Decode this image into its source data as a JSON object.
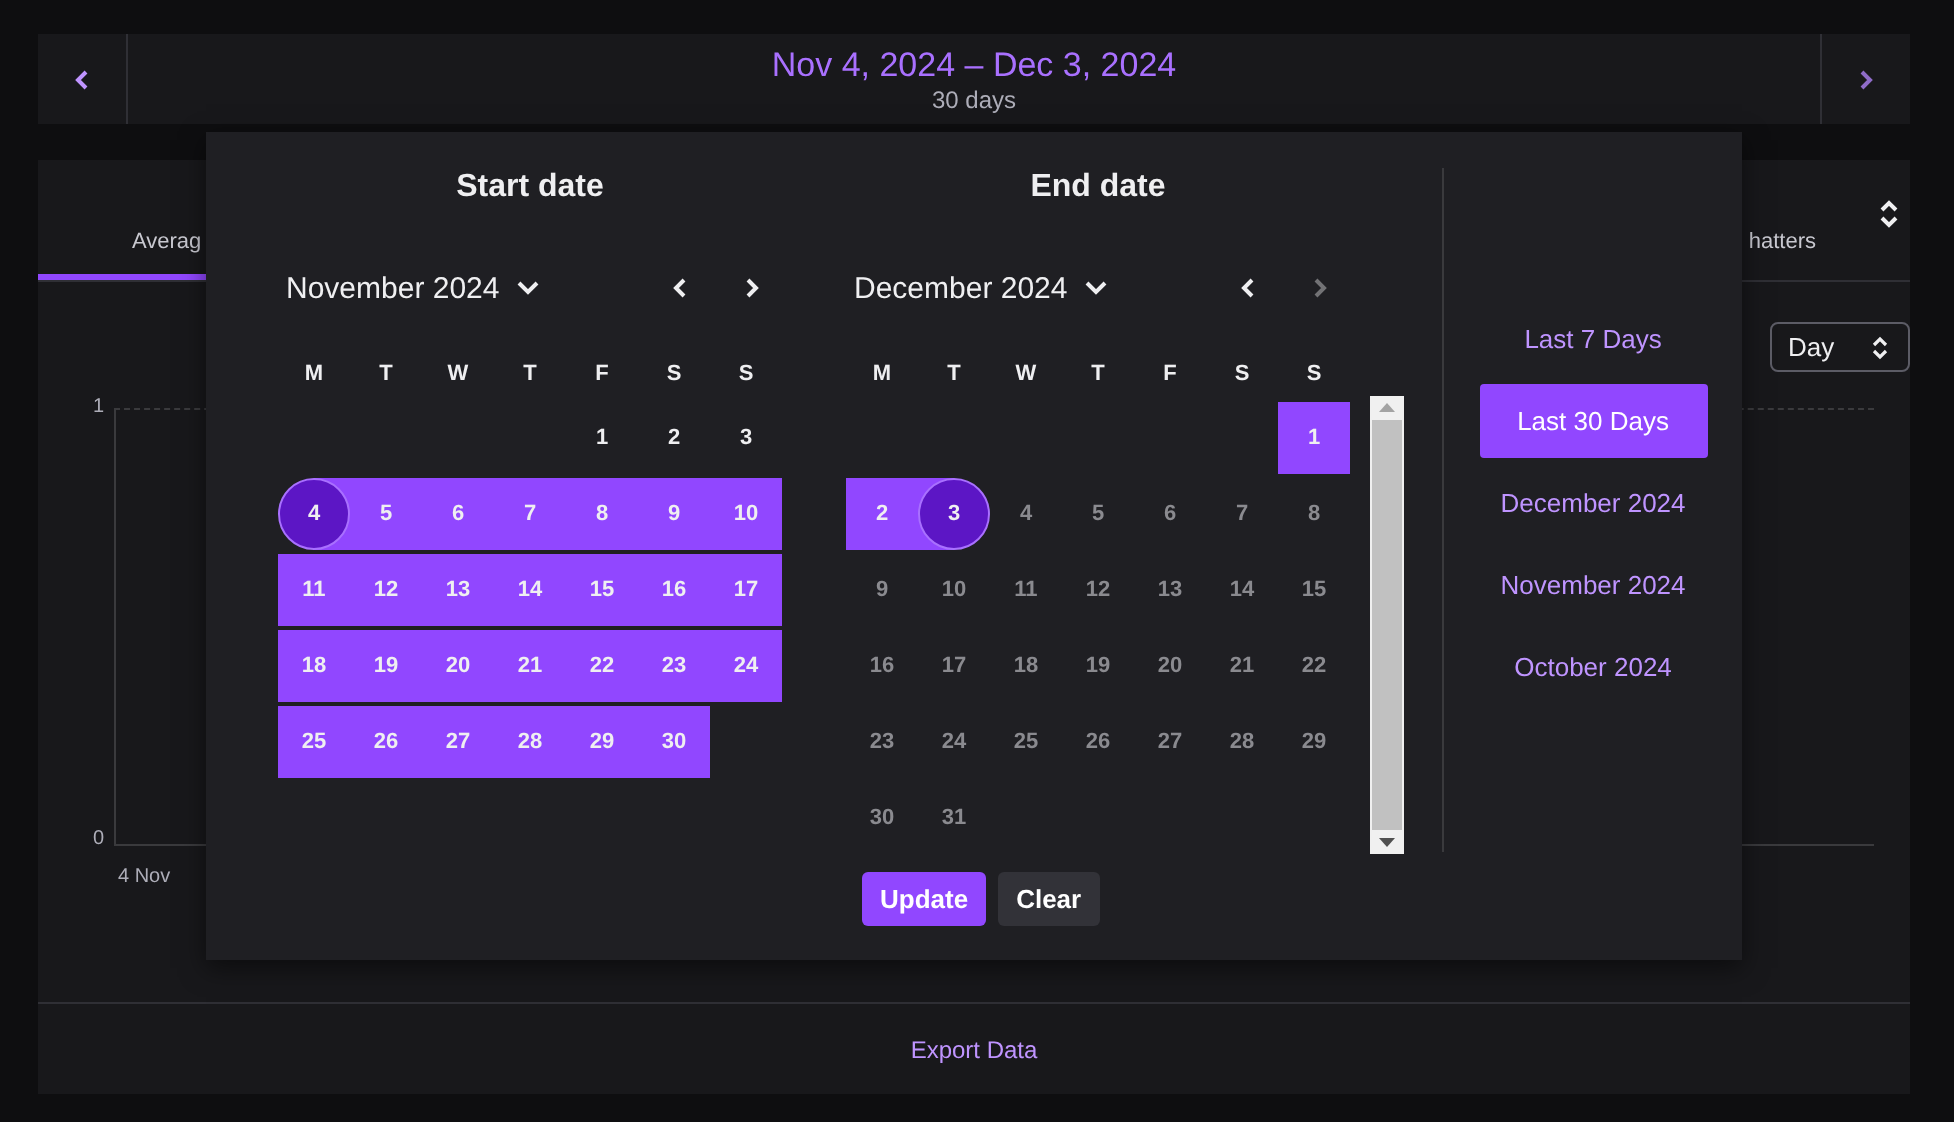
{
  "date_range_bar": {
    "title": "Nov 4, 2024 – Dec 3, 2024",
    "subtitle": "30 days"
  },
  "stats_card": {
    "tabs": [
      {
        "label": "Averag",
        "selected": true
      },
      {
        "label": "hatters",
        "selected": false
      }
    ],
    "interval_select": {
      "value": "Day"
    },
    "chart": {
      "y_labels": [
        "1",
        "0"
      ],
      "x_labels": [
        "4 Nov"
      ]
    },
    "export_button": "Export Data"
  },
  "date_picker": {
    "calendars": [
      {
        "heading": "Start date",
        "month": "November 2024",
        "prev_disabled": false,
        "next_disabled": false,
        "scrollbar": false,
        "weekdays": [
          "M",
          "T",
          "W",
          "T",
          "F",
          "S",
          "S"
        ],
        "weeks": [
          [
            {
              "day": "1",
              "selected": false,
              "dimmed": false
            },
            {
              "day": "2",
              "selected": false,
              "dimmed": false
            },
            {
              "day": "3",
              "selected": false,
              "dimmed": false
            }
          ],
          [
            {
              "day": "4",
              "selected": true,
              "kind": "range_start",
              "dimmed": false
            },
            {
              "day": "5",
              "selected": true,
              "dimmed": false
            },
            {
              "day": "6",
              "selected": true,
              "dimmed": false
            },
            {
              "day": "7",
              "selected": true,
              "dimmed": false
            },
            {
              "day": "8",
              "selected": true,
              "dimmed": false
            },
            {
              "day": "9",
              "selected": true,
              "dimmed": false
            },
            {
              "day": "10",
              "selected": true,
              "dimmed": false
            }
          ],
          [
            {
              "day": "11",
              "selected": true,
              "dimmed": false
            },
            {
              "day": "12",
              "selected": true,
              "dimmed": false
            },
            {
              "day": "13",
              "selected": true,
              "dimmed": false
            },
            {
              "day": "14",
              "selected": true,
              "dimmed": false
            },
            {
              "day": "15",
              "selected": true,
              "dimmed": false
            },
            {
              "day": "16",
              "selected": true,
              "dimmed": false
            },
            {
              "day": "17",
              "selected": true,
              "dimmed": false
            }
          ],
          [
            {
              "day": "18",
              "selected": true,
              "dimmed": false
            },
            {
              "day": "19",
              "selected": true,
              "dimmed": false
            },
            {
              "day": "20",
              "selected": true,
              "dimmed": false
            },
            {
              "day": "21",
              "selected": true,
              "dimmed": false
            },
            {
              "day": "22",
              "selected": true,
              "dimmed": false
            },
            {
              "day": "23",
              "selected": true,
              "dimmed": false
            },
            {
              "day": "24",
              "selected": true,
              "dimmed": false
            }
          ],
          [
            {
              "day": "25",
              "selected": true,
              "dimmed": false
            },
            {
              "day": "26",
              "selected": true,
              "dimmed": false
            },
            {
              "day": "27",
              "selected": true,
              "dimmed": false
            },
            {
              "day": "28",
              "selected": true,
              "dimmed": false
            },
            {
              "day": "29",
              "selected": true,
              "dimmed": false
            },
            {
              "day": "30",
              "selected": true,
              "dimmed": false
            }
          ]
        ]
      },
      {
        "heading": "End date",
        "month": "December 2024",
        "prev_disabled": false,
        "next_disabled": true,
        "scrollbar": true,
        "weekdays": [
          "M",
          "T",
          "W",
          "T",
          "F",
          "S",
          "S"
        ],
        "weeks": [
          [
            {
              "day": "1",
              "selected": true,
              "dimmed": false
            }
          ],
          [
            {
              "day": "2",
              "selected": true,
              "dimmed": false
            },
            {
              "day": "3",
              "selected": true,
              "kind": "range_end",
              "dimmed": false
            },
            {
              "day": "4",
              "selected": false,
              "dimmed": true
            },
            {
              "day": "5",
              "selected": false,
              "dimmed": true
            },
            {
              "day": "6",
              "selected": false,
              "dimmed": true
            },
            {
              "day": "7",
              "selected": false,
              "dimmed": true
            },
            {
              "day": "8",
              "selected": false,
              "dimmed": true
            }
          ],
          [
            {
              "day": "9",
              "selected": false,
              "dimmed": true
            },
            {
              "day": "10",
              "selected": false,
              "dimmed": true
            },
            {
              "day": "11",
              "selected": false,
              "dimmed": true
            },
            {
              "day": "12",
              "selected": false,
              "dimmed": true
            },
            {
              "day": "13",
              "selected": false,
              "dimmed": true
            },
            {
              "day": "14",
              "selected": false,
              "dimmed": true
            },
            {
              "day": "15",
              "selected": false,
              "dimmed": true
            }
          ],
          [
            {
              "day": "16",
              "selected": false,
              "dimmed": true
            },
            {
              "day": "17",
              "selected": false,
              "dimmed": true
            },
            {
              "day": "18",
              "selected": false,
              "dimmed": true
            },
            {
              "day": "19",
              "selected": false,
              "dimmed": true
            },
            {
              "day": "20",
              "selected": false,
              "dimmed": true
            },
            {
              "day": "21",
              "selected": false,
              "dimmed": true
            },
            {
              "day": "22",
              "selected": false,
              "dimmed": true
            }
          ],
          [
            {
              "day": "23",
              "selected": false,
              "dimmed": true
            },
            {
              "day": "24",
              "selected": false,
              "dimmed": true
            },
            {
              "day": "25",
              "selected": false,
              "dimmed": true
            },
            {
              "day": "26",
              "selected": false,
              "dimmed": true
            },
            {
              "day": "27",
              "selected": false,
              "dimmed": true
            },
            {
              "day": "28",
              "selected": false,
              "dimmed": true
            },
            {
              "day": "29",
              "selected": false,
              "dimmed": true
            }
          ],
          [
            {
              "day": "30",
              "selected": false,
              "dimmed": true
            },
            {
              "day": "31",
              "selected": false,
              "dimmed": true
            }
          ]
        ]
      }
    ],
    "buttons": [
      {
        "label": "Update",
        "kind": "primary"
      },
      {
        "label": "Clear",
        "kind": "secondary"
      }
    ],
    "presets": [
      {
        "label": "Last 7 Days",
        "selected": false
      },
      {
        "label": "Last 30 Days",
        "selected": true
      },
      {
        "label": "December 2024",
        "selected": false
      },
      {
        "label": "November 2024",
        "selected": false
      },
      {
        "label": "October 2024",
        "selected": false
      }
    ]
  }
}
